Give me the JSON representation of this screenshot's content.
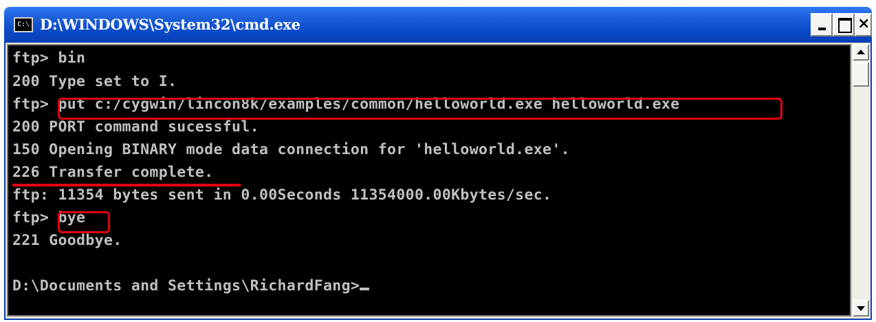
{
  "window": {
    "title": "D:\\WINDOWS\\System32\\cmd.exe",
    "icon": "cmd-icon",
    "icon_text": "C:\\",
    "controls": {
      "minimize": "minimize-icon",
      "maximize": "maximize-icon",
      "close_label": "×"
    }
  },
  "console": {
    "lines": [
      "ftp> bin",
      "200 Type set to I.",
      "ftp> put c:/cygwin/lincon8k/examples/common/helloworld.exe helloworld.exe",
      "200 PORT command sucessful.",
      "150 Opening BINARY mode data connection for 'helloworld.exe'.",
      "226 Transfer complete.",
      "ftp: 11354 bytes sent in 0.00Seconds 11354000.00Kbytes/sec.",
      "ftp> bye",
      "221 Goodbye.",
      "",
      "D:\\Documents and Settings\\RichardFang>"
    ],
    "highlights": [
      {
        "type": "box",
        "text": "put c:/cygwin/lincon8k/examples/common/helloworld.exe helloworld.exe"
      },
      {
        "type": "underline",
        "text": "226 Transfer complete."
      },
      {
        "type": "box",
        "text": "bye"
      }
    ],
    "colors": {
      "background": "#000000",
      "text": "#c0c0c0",
      "highlight": "#e00010",
      "titlebar": "#0a49c6"
    }
  }
}
